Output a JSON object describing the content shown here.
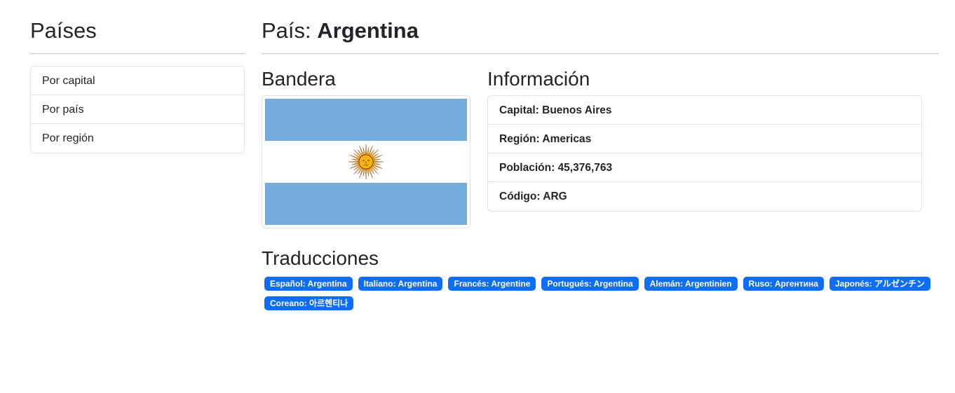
{
  "sidebar": {
    "title": "Países",
    "items": [
      {
        "label": "Por capital"
      },
      {
        "label": "Por país"
      },
      {
        "label": "Por región"
      }
    ]
  },
  "header": {
    "prefix": "País: ",
    "country": "Argentina"
  },
  "flag": {
    "title": "Bandera",
    "colors": {
      "stripe": "#74acdf",
      "white": "#ffffff",
      "sun": "#f6b40e",
      "sun_edge": "#85340a"
    }
  },
  "info": {
    "title": "Información",
    "items": [
      {
        "text": "Capital: Buenos Aires"
      },
      {
        "text": "Región: Americas"
      },
      {
        "text": "Población: 45,376,763"
      },
      {
        "text": "Código: ARG"
      }
    ]
  },
  "translations": {
    "title": "Traducciones",
    "items": [
      {
        "text": "Español: Argentina"
      },
      {
        "text": "Italiano: Argentina"
      },
      {
        "text": "Francés: Argentine"
      },
      {
        "text": "Portugués: Argentina"
      },
      {
        "text": "Alemán: Argentinien"
      },
      {
        "text": "Ruso: Аргентина"
      },
      {
        "text": "Japonés: アルゼンチン"
      },
      {
        "text": "Coreano: 아르헨티나"
      }
    ],
    "badge_color": "#0d6efd"
  }
}
